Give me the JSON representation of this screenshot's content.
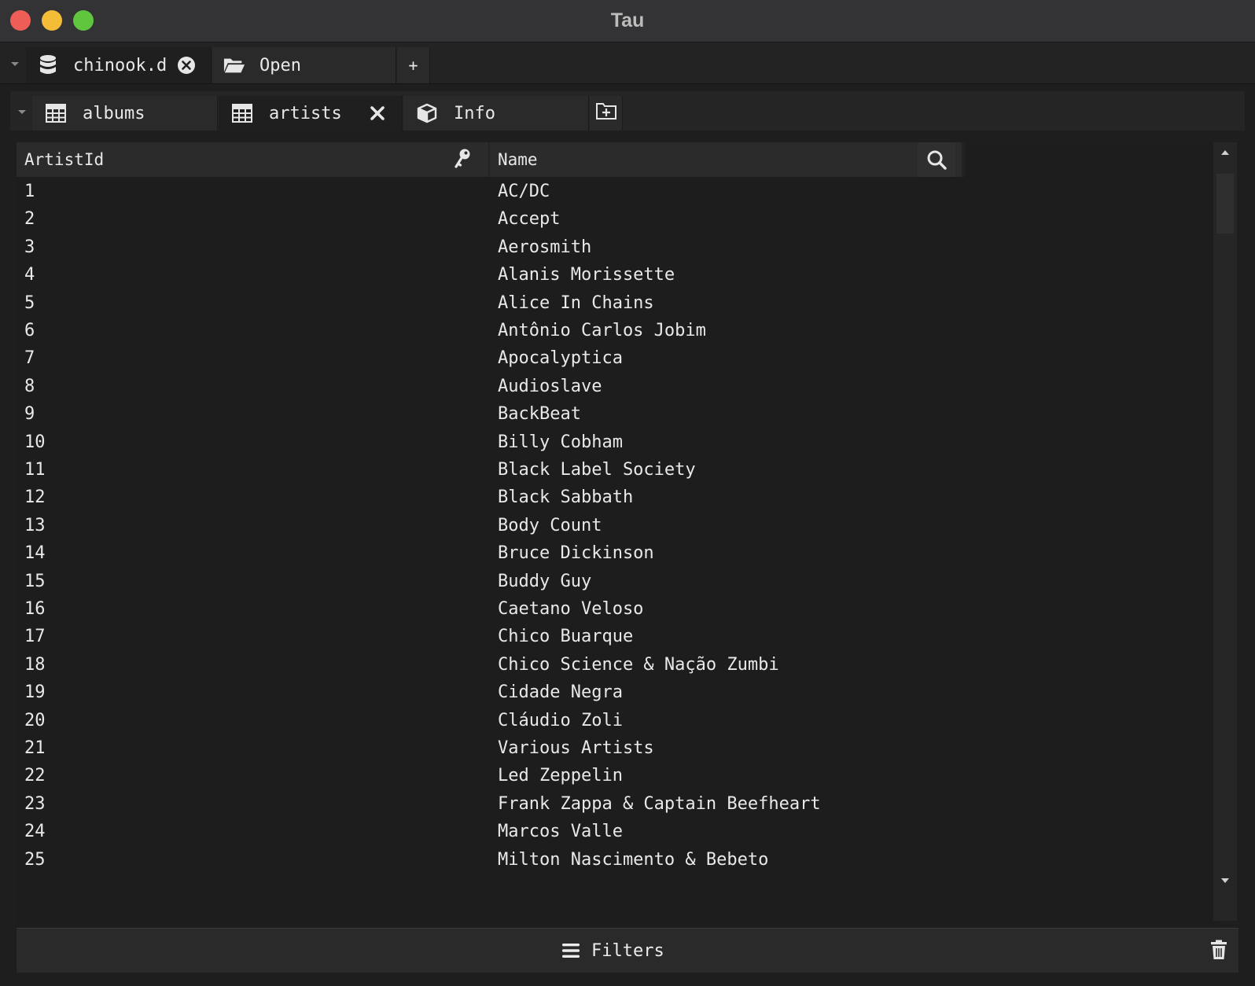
{
  "window": {
    "title": "Tau"
  },
  "file_tabs": [
    {
      "label": "chinook.d",
      "icon": "database-icon"
    },
    {
      "label": "Open",
      "icon": "folder-open-icon"
    }
  ],
  "new_tab_label": "+",
  "table_tabs": [
    {
      "label": "albums",
      "icon": "table-icon"
    },
    {
      "label": "artists",
      "icon": "table-icon"
    },
    {
      "label": "Info",
      "icon": "cube-icon"
    }
  ],
  "columns": [
    {
      "name": "ArtistId",
      "icon": "key-icon"
    },
    {
      "name": "Name",
      "icon": "search-icon"
    }
  ],
  "rows": [
    {
      "id": "1",
      "name": "AC/DC"
    },
    {
      "id": "2",
      "name": "Accept"
    },
    {
      "id": "3",
      "name": "Aerosmith"
    },
    {
      "id": "4",
      "name": "Alanis Morissette"
    },
    {
      "id": "5",
      "name": "Alice In Chains"
    },
    {
      "id": "6",
      "name": "Antônio Carlos Jobim"
    },
    {
      "id": "7",
      "name": "Apocalyptica"
    },
    {
      "id": "8",
      "name": "Audioslave"
    },
    {
      "id": "9",
      "name": "BackBeat"
    },
    {
      "id": "10",
      "name": "Billy Cobham"
    },
    {
      "id": "11",
      "name": "Black Label Society"
    },
    {
      "id": "12",
      "name": "Black Sabbath"
    },
    {
      "id": "13",
      "name": "Body Count"
    },
    {
      "id": "14",
      "name": "Bruce Dickinson"
    },
    {
      "id": "15",
      "name": "Buddy Guy"
    },
    {
      "id": "16",
      "name": "Caetano Veloso"
    },
    {
      "id": "17",
      "name": "Chico Buarque"
    },
    {
      "id": "18",
      "name": "Chico Science & Nação Zumbi"
    },
    {
      "id": "19",
      "name": "Cidade Negra"
    },
    {
      "id": "20",
      "name": "Cláudio Zoli"
    },
    {
      "id": "21",
      "name": "Various Artists"
    },
    {
      "id": "22",
      "name": "Led Zeppelin"
    },
    {
      "id": "23",
      "name": "Frank Zappa & Captain Beefheart"
    },
    {
      "id": "24",
      "name": "Marcos Valle"
    },
    {
      "id": "25",
      "name": "Milton Nascimento & Bebeto"
    }
  ],
  "filters": {
    "label": "Filters"
  },
  "colors": {
    "close_red": "#ee5e56",
    "minimize_yellow": "#f4bd38",
    "zoom_green": "#5fc63e",
    "background": "#1e1e1e"
  }
}
